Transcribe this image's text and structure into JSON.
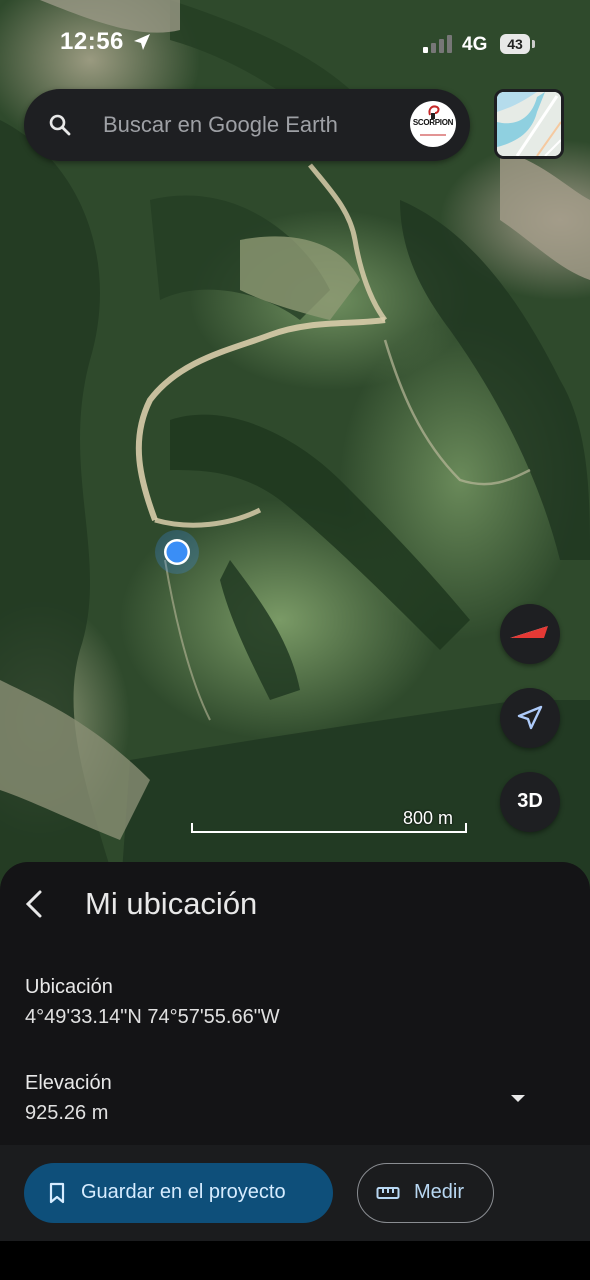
{
  "status_bar": {
    "time": "12:56",
    "network": "4G",
    "battery": "43"
  },
  "search": {
    "placeholder": "Buscar en Google Earth",
    "avatar_text": "SCORPION"
  },
  "map": {
    "scale_label": "800 m",
    "btn_3d": "3D"
  },
  "sheet": {
    "title": "Mi ubicación",
    "location_label": "Ubicación",
    "location_value": "4°49'33.14\"N 74°57'55.66\"W",
    "elevation_label": "Elevación",
    "elevation_value": "925.26 m"
  },
  "actions": {
    "save_label": "Guardar en el proyecto",
    "measure_label": "Medir"
  },
  "icons": {
    "search": "search-icon",
    "location_arrow": "navigation-arrow-icon",
    "compass": "compass-icon",
    "back": "chevron-left-icon",
    "expand": "caret-down-icon",
    "bookmark": "bookmark-icon",
    "ruler": "ruler-icon"
  },
  "colors": {
    "accent": "#0e4f7a",
    "location_dot": "#3a8ef6",
    "compass_red": "#e53935"
  }
}
